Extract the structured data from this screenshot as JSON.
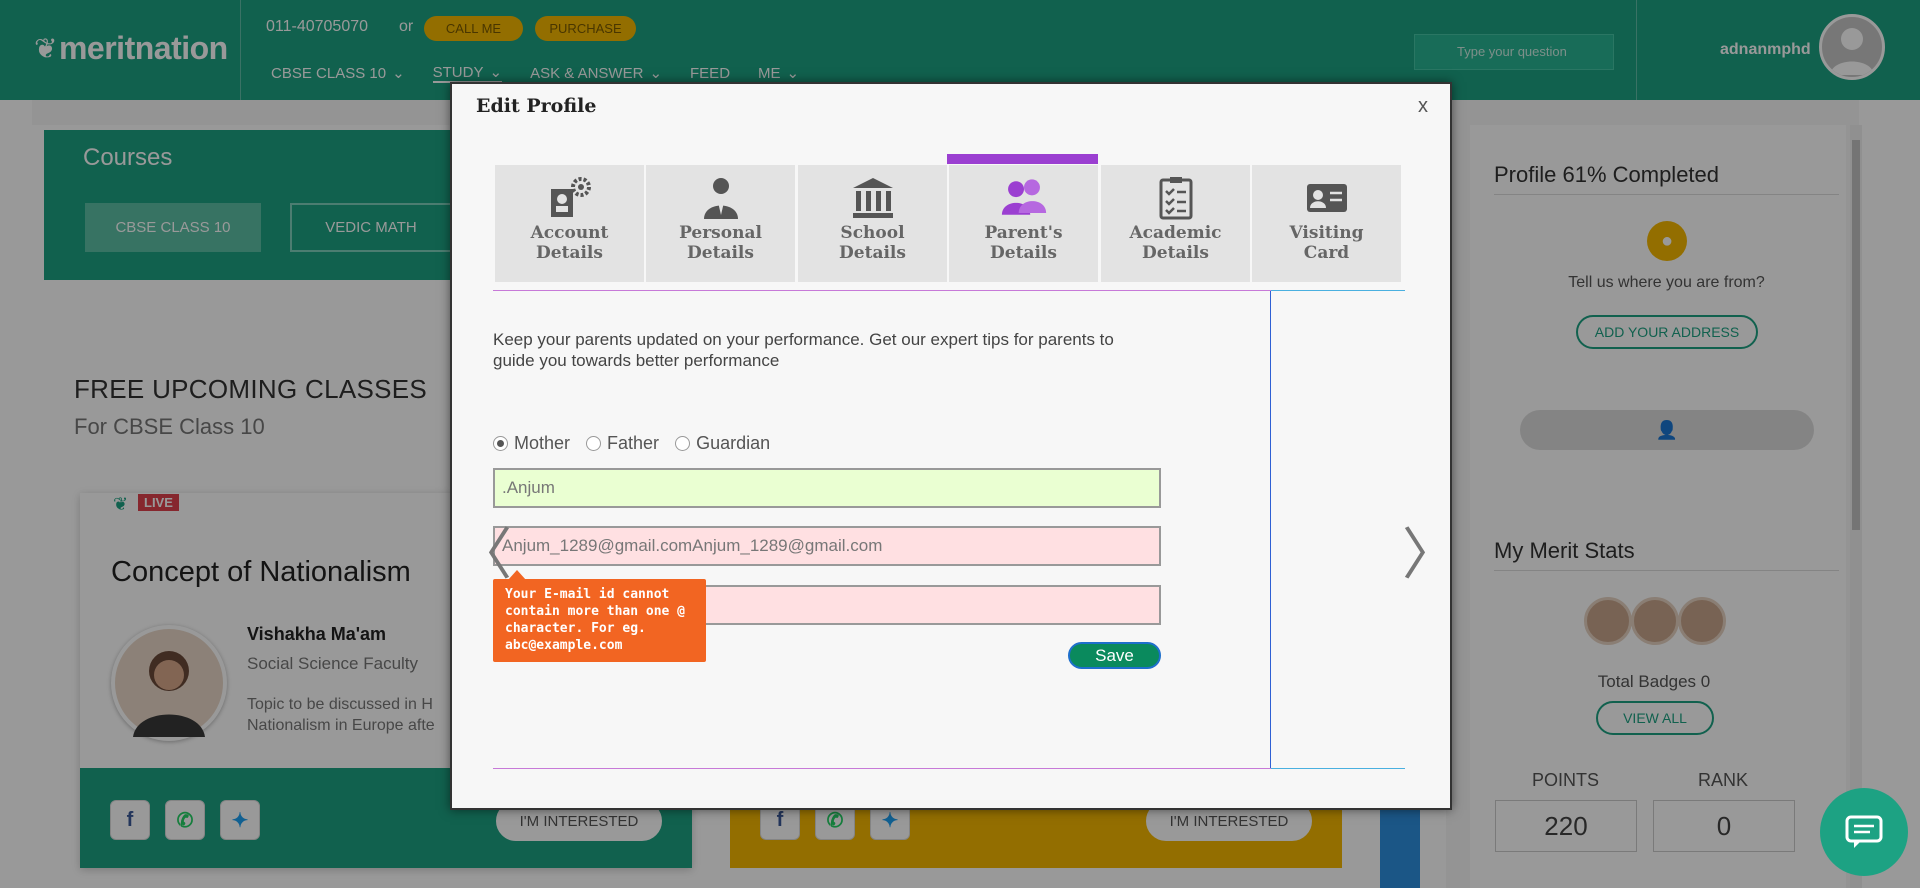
{
  "header": {
    "logo": "meritnation",
    "phone": "011-40705070",
    "or": "or",
    "call_me": "CALL ME",
    "purchase": "PURCHASE",
    "nav": [
      "CBSE CLASS 10",
      "STUDY",
      "ASK & ANSWER",
      "FEED",
      "ME"
    ],
    "search_placeholder": "Type your question",
    "username": "adnanmphd"
  },
  "courses": {
    "title": "Courses",
    "buttons": [
      "CBSE CLASS 10",
      "VEDIC MATH"
    ]
  },
  "free_classes": {
    "title": "FREE UPCOMING CLASSES",
    "subtitle": "For CBSE Class 10",
    "card": {
      "badge": "LIVE",
      "title": "Concept of Nationalism",
      "teacher": "Vishakha Ma'am",
      "faculty": "Social Science Faculty",
      "topic": "Topic to be discussed in H",
      "topic2": "Nationalism in Europe afte",
      "interested": "I'M INTERESTED"
    },
    "card2_interested": "I'M INTERESTED"
  },
  "right_panel": {
    "profile_title": "Profile 61% Completed",
    "tell_us": "Tell us where you are from?",
    "add_address": "ADD YOUR ADDRESS",
    "merit_title": "My Merit Stats",
    "total_badges": "Total Badges 0",
    "view_all": "VIEW ALL",
    "points_label": "POINTS",
    "points_value": "220",
    "rank_label": "RANK",
    "rank_value": "0"
  },
  "modal": {
    "title": "Edit Profile",
    "close": "x",
    "tabs": [
      {
        "line1": "Account",
        "line2": "Details",
        "icon": "account-gear-icon"
      },
      {
        "line1": "Personal",
        "line2": "Details",
        "icon": "person-tie-icon"
      },
      {
        "line1": "School",
        "line2": "Details",
        "icon": "building-columns-icon"
      },
      {
        "line1": "Parent's",
        "line2": "Details",
        "icon": "parents-icon"
      },
      {
        "line1": "Academic",
        "line2": "Details",
        "icon": "clipboard-checklist-icon"
      },
      {
        "line1": "Visiting",
        "line2": "Card",
        "icon": "id-card-icon"
      }
    ],
    "active_tab": 3,
    "intro": "Keep your parents updated on your performance. Get our expert tips for parents to guide you towards better performance",
    "radios": [
      "Mother",
      "Father",
      "Guardian"
    ],
    "selected_radio": "Mother",
    "name_value": ".Anjum",
    "email_value": "Anjum_1289@gmail.comAnjum_1289@gmail.com",
    "phone_value": "",
    "tooltip": "Your E-mail id cannot contain more than one @ character. For eg. abc@example.com",
    "save": "Save",
    "prev_arrow": "〈",
    "next_arrow": "〉"
  }
}
